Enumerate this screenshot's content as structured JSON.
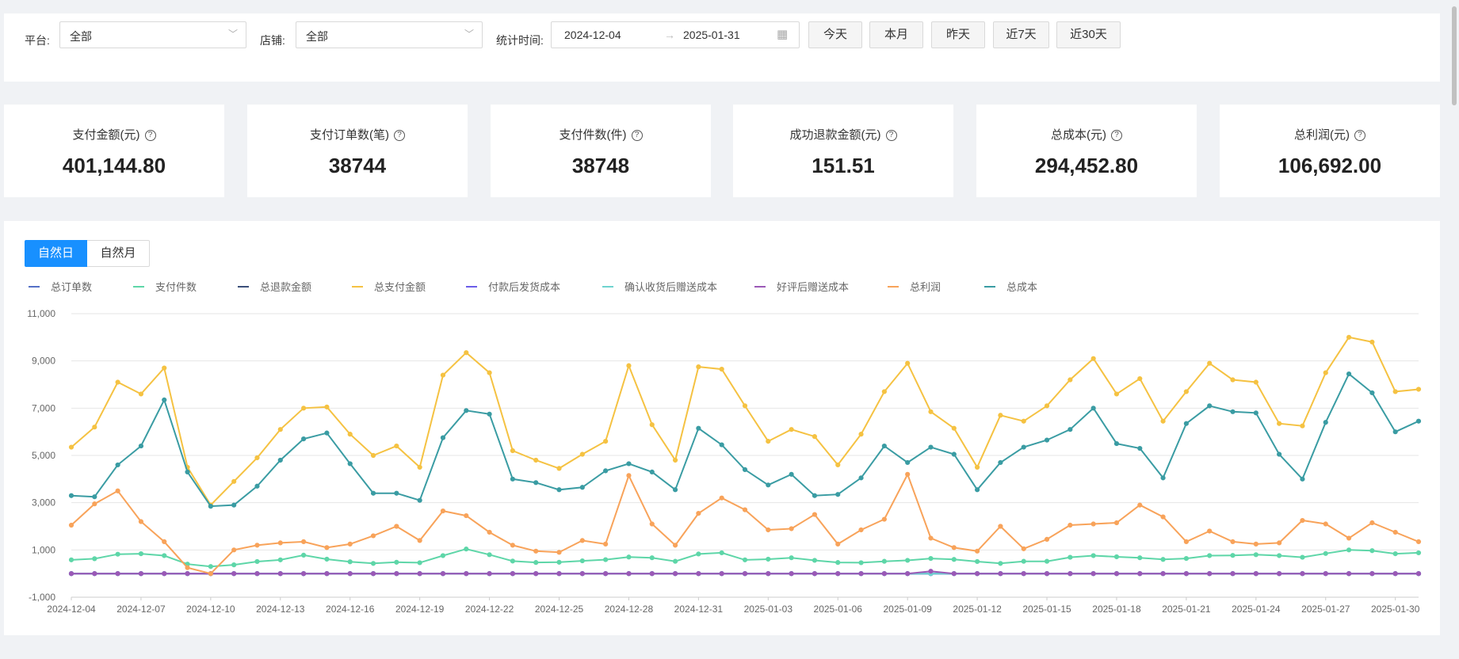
{
  "filters": {
    "platform_label": "平台:",
    "platform_value": "全部",
    "shop_label": "店铺:",
    "shop_value": "全部",
    "time_label": "统计时间:",
    "start_date": "2024-12-04",
    "end_date": "2025-01-31",
    "quick": [
      "今天",
      "本月",
      "昨天",
      "近7天",
      "近30天"
    ]
  },
  "cards": [
    {
      "title": "支付金额(元)",
      "value": "401,144.80"
    },
    {
      "title": "支付订单数(笔)",
      "value": "38744"
    },
    {
      "title": "支付件数(件)",
      "value": "38748"
    },
    {
      "title": "成功退款金额(元)",
      "value": "151.51"
    },
    {
      "title": "总成本(元)",
      "value": "294,452.80"
    },
    {
      "title": "总利润(元)",
      "value": "106,692.00"
    }
  ],
  "tabs": [
    "自然日",
    "自然月"
  ],
  "colors": {
    "accent": "#1890ff",
    "orders": "#5470c6",
    "items": "#5ed6a8",
    "refund": "#3b4f7a",
    "pay_amount": "#f5c242",
    "ship_cost": "#6b5de8",
    "confirm_cost": "#6fd3cf",
    "review_cost": "#9b59b6",
    "profit": "#f8a35a",
    "cost": "#3a9ca3"
  },
  "chart_data": {
    "type": "line",
    "title": "",
    "xlabel": "",
    "ylabel": "",
    "ylim": [
      -1000,
      11000
    ],
    "yticks": [
      "11,000",
      "9,000",
      "7,000",
      "5,000",
      "3,000",
      "1,000",
      "-1,000"
    ],
    "grid": true,
    "legend_position": "top-left",
    "x": [
      "2024-12-04",
      "2024-12-05",
      "2024-12-06",
      "2024-12-07",
      "2024-12-08",
      "2024-12-09",
      "2024-12-10",
      "2024-12-11",
      "2024-12-12",
      "2024-12-13",
      "2024-12-14",
      "2024-12-15",
      "2024-12-16",
      "2024-12-17",
      "2024-12-18",
      "2024-12-19",
      "2024-12-20",
      "2024-12-21",
      "2024-12-22",
      "2024-12-23",
      "2024-12-24",
      "2024-12-25",
      "2024-12-26",
      "2024-12-27",
      "2024-12-28",
      "2024-12-29",
      "2024-12-30",
      "2024-12-31",
      "2025-01-01",
      "2025-01-02",
      "2025-01-03",
      "2025-01-04",
      "2025-01-05",
      "2025-01-06",
      "2025-01-07",
      "2025-01-08",
      "2025-01-09",
      "2025-01-10",
      "2025-01-11",
      "2025-01-12",
      "2025-01-13",
      "2025-01-14",
      "2025-01-15",
      "2025-01-16",
      "2025-01-17",
      "2025-01-18",
      "2025-01-19",
      "2025-01-20",
      "2025-01-21",
      "2025-01-22",
      "2025-01-23",
      "2025-01-24",
      "2025-01-25",
      "2025-01-26",
      "2025-01-27",
      "2025-01-28",
      "2025-01-29",
      "2025-01-30",
      "2025-01-31"
    ],
    "x_tick_labels": [
      "2024-12-04",
      "2024-12-07",
      "2024-12-10",
      "2024-12-13",
      "2024-12-16",
      "2024-12-19",
      "2024-12-22",
      "2024-12-25",
      "2024-12-28",
      "2024-12-31",
      "2025-01-03",
      "2025-01-06",
      "2025-01-09",
      "2025-01-12",
      "2025-01-15",
      "2025-01-18",
      "2025-01-21",
      "2025-01-24",
      "2025-01-27",
      "2025-01-30"
    ],
    "series": [
      {
        "name": "总订单数",
        "color_key": "orders",
        "values": [
          0,
          0,
          0,
          0,
          0,
          0,
          0,
          0,
          0,
          0,
          0,
          0,
          0,
          0,
          0,
          0,
          0,
          0,
          0,
          0,
          0,
          0,
          0,
          0,
          0,
          0,
          0,
          0,
          0,
          0,
          0,
          0,
          0,
          0,
          0,
          0,
          0,
          0,
          0,
          0,
          0,
          0,
          0,
          0,
          0,
          0,
          0,
          0,
          0,
          0,
          0,
          0,
          0,
          0,
          0,
          0,
          0,
          0,
          0
        ]
      },
      {
        "name": "支付件数",
        "color_key": "items",
        "values": [
          580,
          630,
          820,
          840,
          760,
          400,
          300,
          370,
          510,
          580,
          780,
          610,
          500,
          430,
          480,
          460,
          760,
          1040,
          800,
          530,
          470,
          480,
          540,
          590,
          700,
          670,
          520,
          830,
          880,
          580,
          610,
          670,
          560,
          470,
          460,
          520,
          560,
          640,
          600,
          510,
          430,
          520,
          520,
          690,
          760,
          710,
          670,
          600,
          640,
          760,
          770,
          800,
          760,
          690,
          850,
          1000,
          970,
          840,
          880
        ]
      },
      {
        "name": "总退款金额",
        "color_key": "refund",
        "values": [
          0,
          0,
          0,
          0,
          0,
          0,
          0,
          0,
          0,
          0,
          0,
          0,
          0,
          0,
          0,
          0,
          0,
          0,
          0,
          0,
          0,
          0,
          0,
          0,
          0,
          0,
          0,
          0,
          0,
          0,
          0,
          0,
          0,
          0,
          0,
          0,
          0,
          0,
          0,
          0,
          0,
          0,
          0,
          0,
          0,
          0,
          0,
          0,
          0,
          0,
          0,
          0,
          0,
          0,
          0,
          0,
          0,
          0,
          0
        ]
      },
      {
        "name": "总支付金额",
        "color_key": "pay_amount",
        "values": [
          5350,
          6200,
          8100,
          7600,
          8700,
          4500,
          2900,
          3900,
          4900,
          6100,
          7000,
          7050,
          5900,
          5000,
          5400,
          4500,
          8400,
          9350,
          8500,
          5200,
          4800,
          4450,
          5050,
          5600,
          8800,
          6300,
          4800,
          8750,
          8650,
          7100,
          5600,
          6100,
          5800,
          4600,
          5900,
          7700,
          8900,
          6850,
          6150,
          4500,
          6700,
          6450,
          7100,
          8200,
          9100,
          7600,
          8250,
          6450,
          7700,
          8900,
          8200,
          8100,
          6350,
          6250,
          8500,
          10000,
          9800,
          7700,
          7800
        ]
      },
      {
        "name": "付款后发货成本",
        "color_key": "ship_cost",
        "values": [
          0,
          0,
          0,
          0,
          0,
          0,
          0,
          0,
          0,
          0,
          0,
          0,
          0,
          0,
          0,
          0,
          0,
          0,
          0,
          0,
          0,
          0,
          0,
          0,
          0,
          0,
          0,
          0,
          0,
          0,
          0,
          0,
          0,
          0,
          0,
          0,
          0,
          0,
          0,
          0,
          0,
          0,
          0,
          0,
          0,
          0,
          0,
          0,
          0,
          0,
          0,
          0,
          0,
          0,
          0,
          0,
          0,
          0,
          0
        ]
      },
      {
        "name": "确认收货后赠送成本",
        "color_key": "confirm_cost",
        "values": [
          0,
          0,
          0,
          0,
          0,
          0,
          0,
          0,
          0,
          0,
          0,
          0,
          0,
          0,
          0,
          0,
          0,
          0,
          0,
          0,
          0,
          0,
          0,
          0,
          0,
          0,
          0,
          0,
          0,
          0,
          0,
          0,
          0,
          0,
          0,
          0,
          0,
          0,
          0,
          0,
          0,
          0,
          0,
          0,
          0,
          0,
          0,
          0,
          0,
          0,
          0,
          0,
          0,
          0,
          0,
          0,
          0,
          0,
          0
        ]
      },
      {
        "name": "好评后赠送成本",
        "color_key": "review_cost",
        "values": [
          0,
          0,
          0,
          0,
          0,
          0,
          0,
          0,
          0,
          0,
          0,
          0,
          0,
          0,
          0,
          0,
          0,
          0,
          0,
          0,
          0,
          0,
          0,
          0,
          0,
          0,
          0,
          0,
          0,
          0,
          0,
          0,
          0,
          0,
          0,
          0,
          0,
          100,
          0,
          0,
          0,
          0,
          0,
          0,
          0,
          0,
          0,
          0,
          0,
          0,
          0,
          0,
          0,
          0,
          0,
          0,
          0,
          0,
          0
        ]
      },
      {
        "name": "总利润",
        "color_key": "profit",
        "values": [
          2050,
          2950,
          3500,
          2200,
          1350,
          250,
          0,
          1000,
          1200,
          1300,
          1350,
          1100,
          1250,
          1600,
          2000,
          1400,
          2650,
          2450,
          1750,
          1200,
          950,
          900,
          1400,
          1250,
          4150,
          2100,
          1200,
          2550,
          3200,
          2700,
          1850,
          1900,
          2500,
          1250,
          1850,
          2300,
          4200,
          1500,
          1100,
          950,
          2000,
          1050,
          1450,
          2050,
          2100,
          2150,
          2900,
          2400,
          1350,
          1800,
          1350,
          1250,
          1300,
          2250,
          2100,
          1500,
          2150,
          1750,
          1350
        ]
      },
      {
        "name": "总成本",
        "color_key": "cost",
        "values": [
          3300,
          3250,
          4600,
          5400,
          7350,
          4300,
          2850,
          2900,
          3700,
          4800,
          5700,
          5950,
          4650,
          3400,
          3400,
          3100,
          5750,
          6900,
          6750,
          4000,
          3850,
          3550,
          3650,
          4350,
          4650,
          4300,
          3550,
          6150,
          5450,
          4400,
          3750,
          4200,
          3300,
          3350,
          4050,
          5400,
          4700,
          5350,
          5050,
          3550,
          4700,
          5350,
          5650,
          6100,
          7000,
          5500,
          5300,
          4050,
          6350,
          7100,
          6850,
          6800,
          5050,
          4000,
          6400,
          8450,
          7650,
          6000,
          6450
        ]
      }
    ]
  }
}
